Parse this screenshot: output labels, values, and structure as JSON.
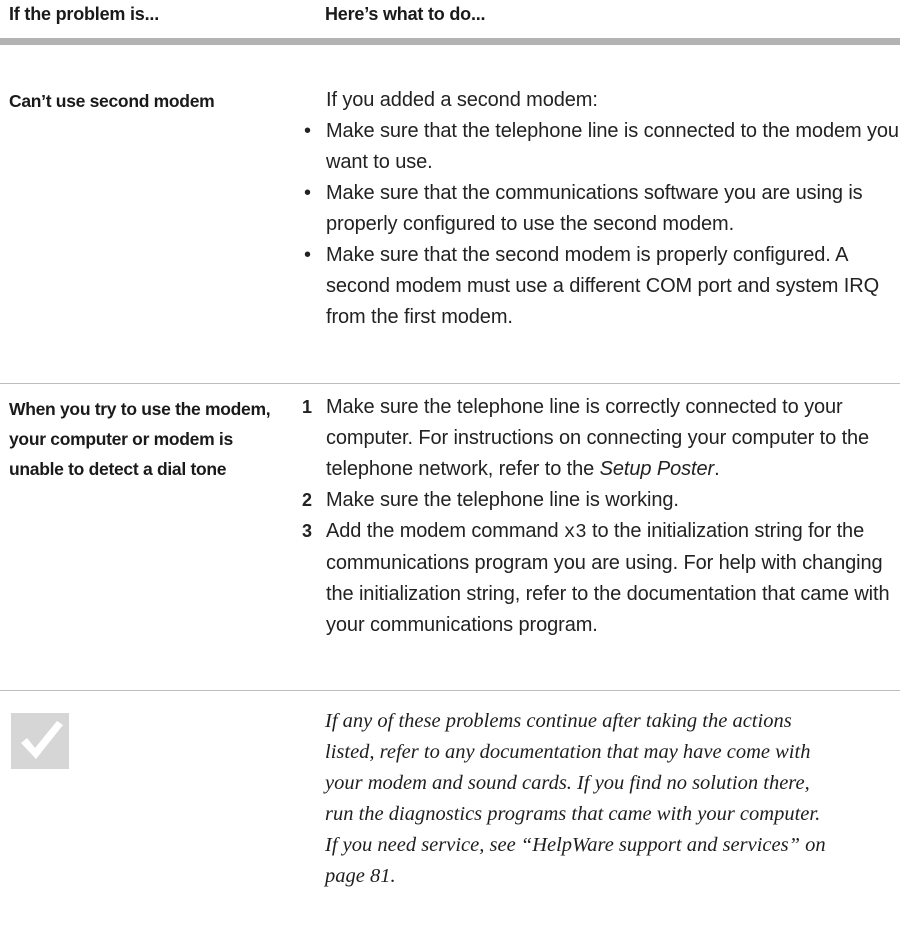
{
  "header": {
    "problem_col": "If the problem is...",
    "action_col": "Here’s what to do..."
  },
  "rows": [
    {
      "problem": "Can’t use second modem",
      "intro": "If you added a second modem:",
      "bullets": [
        "Make sure that the telephone line is connected to the modem you want to use.",
        "Make sure that the communications software you are using is properly configured to use the second modem.",
        "Make sure that the second modem is properly configured. A second modem must use a different COM port and system IRQ from the first modem."
      ]
    },
    {
      "problem": "When you try to use the modem, your computer or modem is unable to detect a dial tone",
      "steps": [
        {
          "num": "1",
          "text_before": "Make sure the telephone line is correctly connected to your computer. For instructions on connecting your computer to the telephone network, refer to the ",
          "text_italic": "Setup Poster",
          "text_after": "."
        },
        {
          "num": "2",
          "text": "Make sure the telephone line is working."
        },
        {
          "num": "3",
          "text_before": "Add the modem command ",
          "code": "x3",
          "text_after": " to the initialization string for the communications program you are using. For help with changing the initialization string, refer to the documentation that came with your communications program."
        }
      ]
    }
  ],
  "note": {
    "icon": "checkmark-icon",
    "lines": [
      "If any of these problems continue after taking the actions",
      "listed, refer to any documentation that may have come with",
      "your modem and sound cards. If you find no solution there,",
      "run the diagnostics programs that came with your computer.",
      "If you need service, see “HelpWare support and services” on",
      "page 81."
    ]
  }
}
